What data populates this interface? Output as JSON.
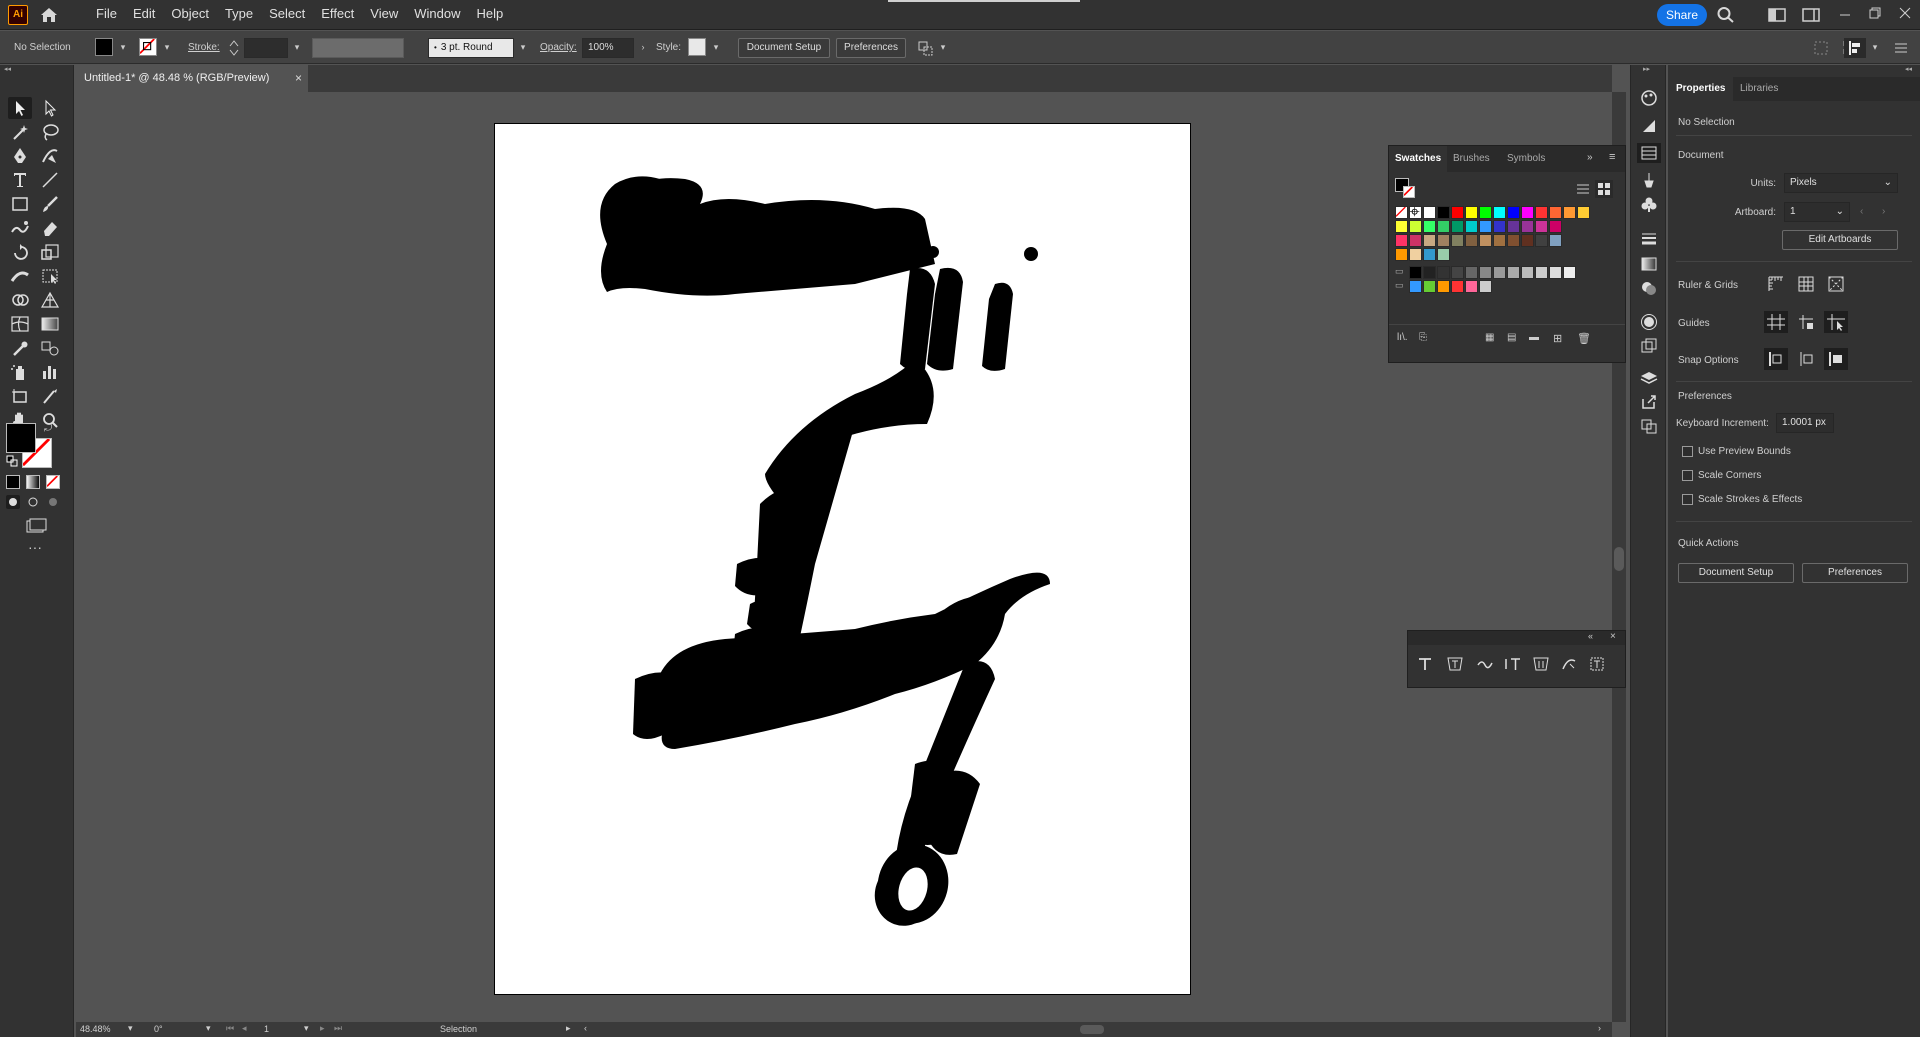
{
  "app": {
    "logo_text": "Ai",
    "menus": [
      "File",
      "Edit",
      "Object",
      "Type",
      "Select",
      "Effect",
      "View",
      "Window",
      "Help"
    ],
    "share_label": "Share"
  },
  "control_bar": {
    "selection_status": "No Selection",
    "stroke_label": "Stroke:",
    "brush_label": "3 pt. Round",
    "opacity_label": "Opacity:",
    "opacity_value": "100%",
    "style_label": "Style:",
    "document_setup": "Document Setup",
    "preferences": "Preferences"
  },
  "document": {
    "tab_title": "Untitled-1* @ 48.48 % (RGB/Preview)",
    "close_glyph": "×"
  },
  "status_bar": {
    "zoom": "48.48%",
    "rotation": "0°",
    "artboard_number": "1",
    "tool_name": "Selection"
  },
  "swatches_panel": {
    "tabs": [
      "Swatches",
      "Brushes",
      "Symbols"
    ],
    "colors": {
      "row1": [
        "#ffffff",
        "#000000",
        "#ff0000",
        "#ffff00",
        "#00ff00",
        "#00ffff",
        "#0000ff",
        "#ff00ff",
        "#ff3333",
        "#ff6633",
        "#ff9933",
        "#ffcc33"
      ],
      "row2": [
        "#ffff33",
        "#ccff33",
        "#33ff66",
        "#33cc66",
        "#009966",
        "#00cccc",
        "#3399ff",
        "#3333cc",
        "#663399",
        "#993399",
        "#cc3399",
        "#cc0066"
      ],
      "row3": [
        "#ff3366",
        "#cc3366",
        "#c8a882",
        "#a08060",
        "#808060",
        "#806040",
        "#c09060",
        "#a07040",
        "#805030",
        "#603020",
        "#404040",
        "#80a0c0"
      ],
      "row4": [
        "#ff9900",
        "#f0d0a0",
        "#3399cc",
        "#99ccaa"
      ],
      "row5": [
        "#000000",
        "#222222",
        "#333333",
        "#444444",
        "#666666",
        "#888888",
        "#999999",
        "#aaaaaa",
        "#bbbbbb",
        "#cccccc",
        "#dddddd",
        "#eeeeee"
      ],
      "row6": [
        "#3399ff",
        "#66cc33",
        "#ff9900",
        "#ff3333",
        "#ff6699",
        "#cccccc"
      ]
    }
  },
  "properties_panel": {
    "tabs": [
      "Properties",
      "Libraries"
    ],
    "selection_status": "No Selection",
    "document_heading": "Document",
    "units_label": "Units:",
    "units_value": "Pixels",
    "artboard_label": "Artboard:",
    "artboard_value": "1",
    "edit_artboards": "Edit Artboards",
    "ruler_grids": "Ruler & Grids",
    "guides": "Guides",
    "snap_options": "Snap Options",
    "preferences_heading": "Preferences",
    "keyboard_increment_label": "Keyboard Increment:",
    "keyboard_increment_value": "1.0001 px",
    "use_preview_bounds": "Use Preview Bounds",
    "scale_corners": "Scale Corners",
    "scale_strokes": "Scale Strokes & Effects",
    "quick_actions": "Quick Actions",
    "document_setup": "Document Setup",
    "preferences": "Preferences"
  },
  "colors": {
    "accent": "#1473e6",
    "fill": "#000000",
    "stroke_none": "#ff0000"
  }
}
